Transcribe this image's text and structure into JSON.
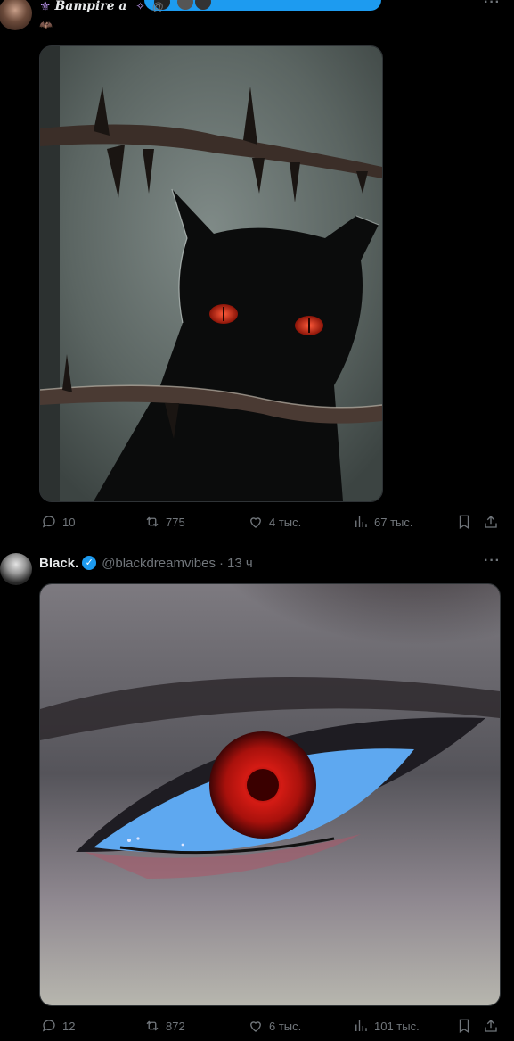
{
  "tweet1": {
    "display_name": "Bampire a",
    "handle": "@",
    "image_alt": "black cat with red eyes behind thorny branch",
    "stats": {
      "replies": "10",
      "reposts": "775",
      "likes": "4 тыс.",
      "views": "67 тыс."
    }
  },
  "tweet2": {
    "display_name": "Black.",
    "handle": "@blackdreamvibes",
    "separator": "·",
    "time": "13 ч",
    "image_alt": "close-up of eye with red iris",
    "stats": {
      "replies": "12",
      "reposts": "872",
      "likes": "6 тыс.",
      "views": "101 тыс."
    }
  },
  "colors": {
    "background": "#000000",
    "accent": "#1d9bf0",
    "muted": "#71767b",
    "divider": "#2f3336"
  },
  "icons": [
    "reply-icon",
    "repost-icon",
    "like-icon",
    "views-icon",
    "bookmark-icon",
    "share-icon",
    "more-icon",
    "verified-icon"
  ]
}
